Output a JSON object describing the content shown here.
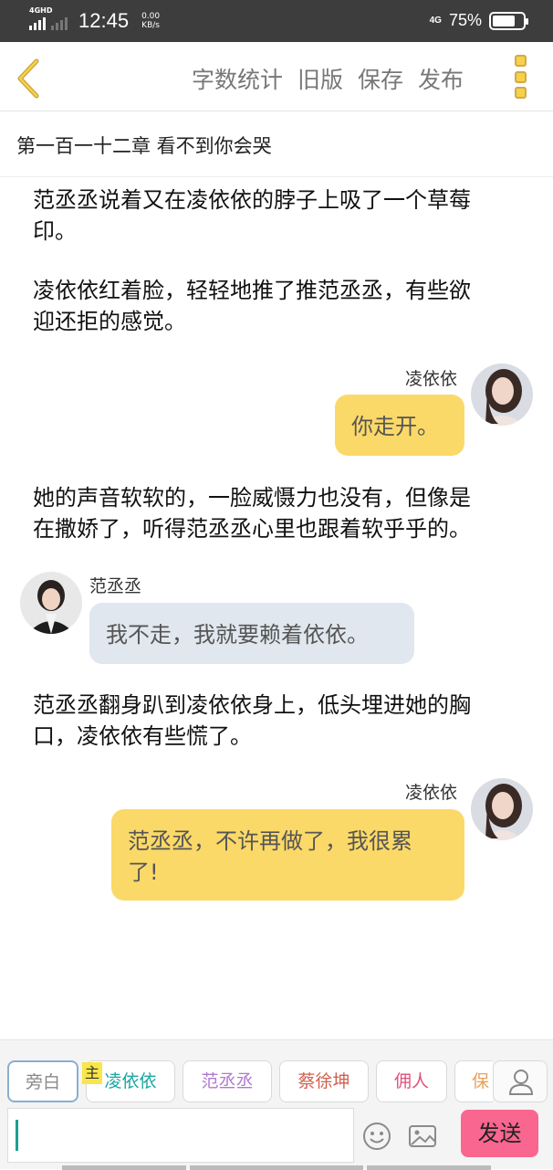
{
  "status_bar": {
    "network_left": "4GHD",
    "time": "12:45",
    "speed_value": "0.00",
    "speed_unit": "KB/s",
    "network_right": "4G",
    "battery": "75%",
    "battery_level": 0.75
  },
  "toolbar": {
    "word_count": "字数统计",
    "old_version": "旧版",
    "save": "保存",
    "publish": "发布"
  },
  "chapter_title": "第一百一十二章  看不到你会哭",
  "story": {
    "narration1_line1": "范丞丞说着又在凌依依的脖子上吸了一个草莓",
    "narration1_line2": "印。",
    "narration2_line1": "凌依依红着脸，轻轻地推了推范丞丞，有些欲",
    "narration2_line2": "迎还拒的感觉。",
    "msg1_name": "凌依依",
    "msg1_text": "你走开。",
    "narration3_line1": "她的声音软软的，一脸威慑力也没有，但像是",
    "narration3_line2": "在撒娇了，听得范丞丞心里也跟着软乎乎的。",
    "msg2_name": "范丞丞",
    "msg2_text": "我不走，我就要赖着依依。",
    "narration4_line1": "范丞丞翻身趴到凌依依身上，低头埋进她的胸",
    "narration4_line2": "口，凌依依有些慌了。",
    "msg3_name": "凌依依",
    "msg3_line1": "范丞丞，不许再做了，我很累",
    "msg3_line2": "了!"
  },
  "characters": {
    "narrator": "旁白",
    "host_tag": "主",
    "c1": "凌依依",
    "c2": "范丞丞",
    "c3": "蔡徐坤",
    "c4": "佣人",
    "c5": "保"
  },
  "input": {
    "value": ""
  },
  "send_label": "发送",
  "colors": {
    "yellow_bubble": "#fbd968",
    "blue_bubble": "#e1e7ee",
    "send_button": "#f9668f",
    "accent_gold": "#d4a84a"
  }
}
